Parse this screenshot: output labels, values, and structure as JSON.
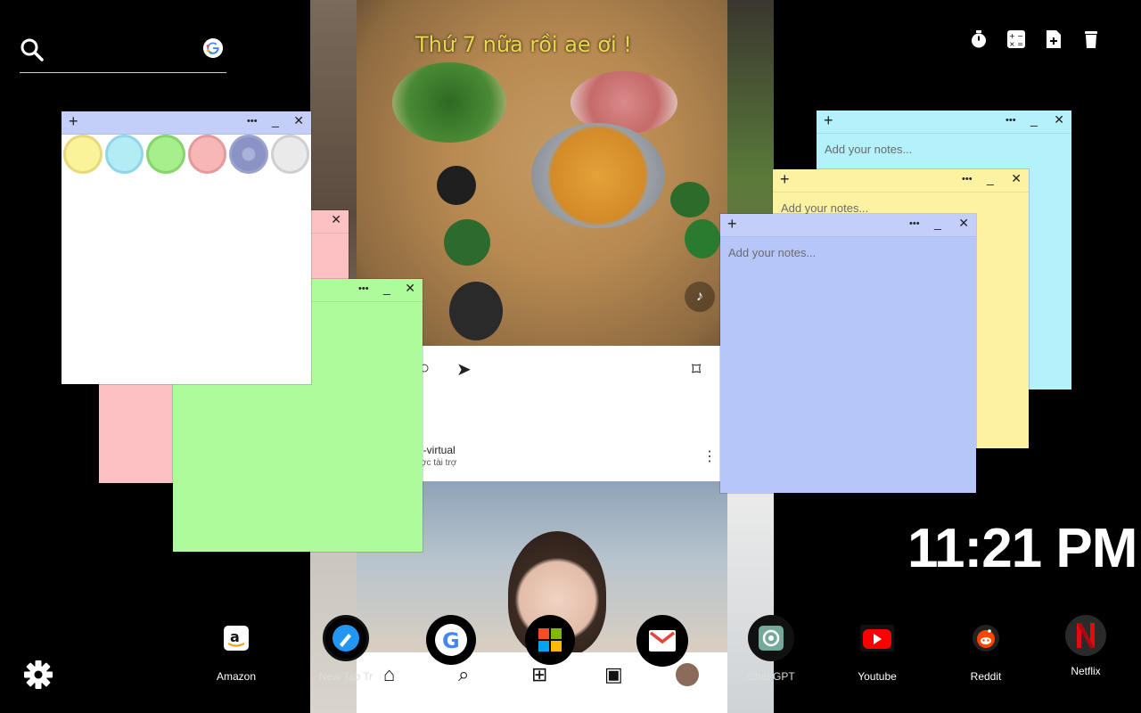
{
  "search": {
    "placeholder": "",
    "value": "",
    "engine_icon": "google-icon"
  },
  "tools": [
    {
      "name": "timer-icon"
    },
    {
      "name": "calculator-icon"
    },
    {
      "name": "new-document-icon"
    },
    {
      "name": "trash-icon"
    }
  ],
  "wallpaper": {
    "caption": "Thứ 7 nữa rồi ae ơi !",
    "post_user": "i-virtual",
    "post_sub": "ợc tài trợ"
  },
  "notes": [
    {
      "id": "white-palette",
      "placeholder": ""
    },
    {
      "id": "pink",
      "placeholder": ""
    },
    {
      "id": "green",
      "placeholder": ""
    },
    {
      "id": "cyan",
      "placeholder": "Add your notes..."
    },
    {
      "id": "yellow",
      "placeholder": "Add your notes..."
    },
    {
      "id": "blue",
      "placeholder": "Add your notes..."
    }
  ],
  "note_controls": {
    "add": "+",
    "more": "•••",
    "minimize": "_",
    "close": "✕"
  },
  "palette": [
    "#fbf39a",
    "#b4ecf6",
    "#a7ee8d",
    "#f8b7b7",
    "#aab2da",
    "#eaeaea"
  ],
  "colors": {
    "pink": "#fdc1c3",
    "green": "#aefb9b",
    "cyan": "#b3f1fb",
    "yellow": "#fdf2a2",
    "blue": "#b7c6f9",
    "blue_bar": "#c3cffa",
    "white_bar": "#c3cff8"
  },
  "clock": {
    "time": "11:21 PM"
  },
  "dock": [
    {
      "label": "Amazon",
      "icon": "amazon-icon"
    },
    {
      "label": "New Tab Tr",
      "icon": "new-tab-tracker-icon"
    },
    {
      "label": "",
      "icon": "google-icon"
    },
    {
      "label": "",
      "icon": "microsoft-icon"
    },
    {
      "label": "",
      "icon": "gmail-icon"
    },
    {
      "label": "Chat GPT",
      "icon": "chatgpt-icon"
    },
    {
      "label": "Youtube",
      "icon": "youtube-icon"
    },
    {
      "label": "Reddit",
      "icon": "reddit-icon"
    },
    {
      "label": "Netflix",
      "icon": "netflix-icon"
    }
  ]
}
